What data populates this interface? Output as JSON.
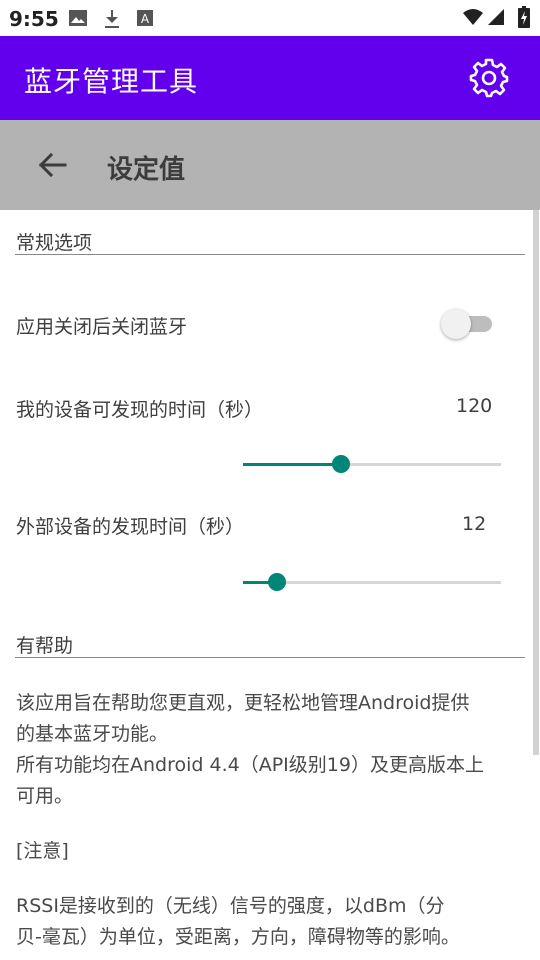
{
  "status_bar": {
    "time": "9:55",
    "icons": [
      "image-icon",
      "download-icon",
      "font-icon",
      "wifi-icon",
      "signal-icon",
      "battery-icon"
    ]
  },
  "app_bar": {
    "title": "蓝牙管理工具",
    "background": "#6200ee",
    "settings_icon": "gear-icon"
  },
  "sub_header": {
    "back_icon": "arrow-left-icon",
    "title": "设定值"
  },
  "general": {
    "section_title": "常规选项",
    "close_bt_label": "应用关闭后关闭蓝牙",
    "close_bt_enabled": false,
    "discoverable_label": "我的设备可发现的时间（秒）",
    "discoverable_value": "120",
    "discoverable_fraction": 0.38,
    "scan_label": "外部设备的发现时间（秒）",
    "scan_value": "12",
    "scan_fraction": 0.13,
    "accent": "#008577"
  },
  "help": {
    "section_title": "有帮助",
    "para1_line1": "该应用旨在帮助您更直观，更轻松地管理Android提供",
    "para1_line2": "的基本蓝牙功能。",
    "para1_line3": "所有功能均在Android 4.4（API级别19）及更高版本上",
    "para1_line4": "可用。",
    "note": "[注意]",
    "para2_line1": "RSSI是接收到的（无线）信号的强度，以dBm（分",
    "para2_line2": "贝-毫瓦）为单位，受距离，方向，障碍物等的影响。"
  }
}
